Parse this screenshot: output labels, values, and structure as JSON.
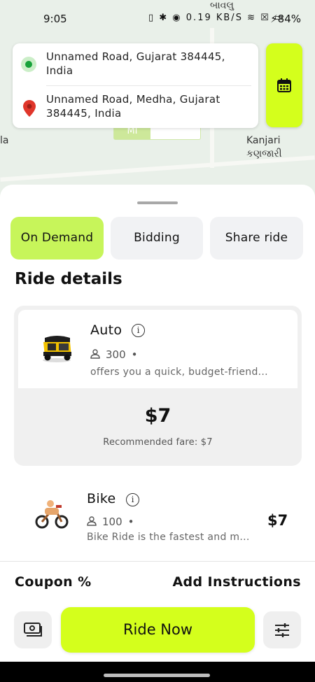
{
  "status_bar": {
    "time": "9:05",
    "indicators": "▯ ✱ ◉ 0.19 KB/S ≋ ☒ ▭",
    "battery": "⚡84%"
  },
  "map": {
    "label_top": "બાવલુ",
    "label_left": "la",
    "place_name": "Kanjari",
    "place_name_local": "કણજારી",
    "scale_unit": "MI"
  },
  "route": {
    "origin": "Unnamed Road, Gujarat 384445, India",
    "destination": "Unnamed Road, Medha, Gujarat 384445, India"
  },
  "tabs": [
    {
      "label": "On Demand",
      "active": true
    },
    {
      "label": "Bidding",
      "active": false
    },
    {
      "label": "Share ride",
      "active": false
    }
  ],
  "section_title": "Ride details",
  "vehicles": [
    {
      "name": "Auto",
      "capacity": "300",
      "bullet": "•",
      "description": "offers you a quick, budget-friend...",
      "price": "$7",
      "recommended": "Recommended fare: $7",
      "selected": true
    },
    {
      "name": "Bike",
      "capacity": "100",
      "bullet": "•",
      "description": "Bike Ride is the fastest and m...",
      "price": "$7",
      "selected": false
    }
  ],
  "footer": {
    "coupon": "Coupon %",
    "instructions": "Add Instructions",
    "ride_now": "Ride Now"
  },
  "colors": {
    "accent": "#d4ff1c",
    "tab_active": "#c7f55a",
    "origin_pin": "#17a23a",
    "dest_pin": "#e0362b"
  },
  "icons": [
    "calendar-icon",
    "origin-pin-icon",
    "destination-pin-icon",
    "info-icon",
    "person-icon",
    "wallet-icon",
    "filter-icon"
  ]
}
